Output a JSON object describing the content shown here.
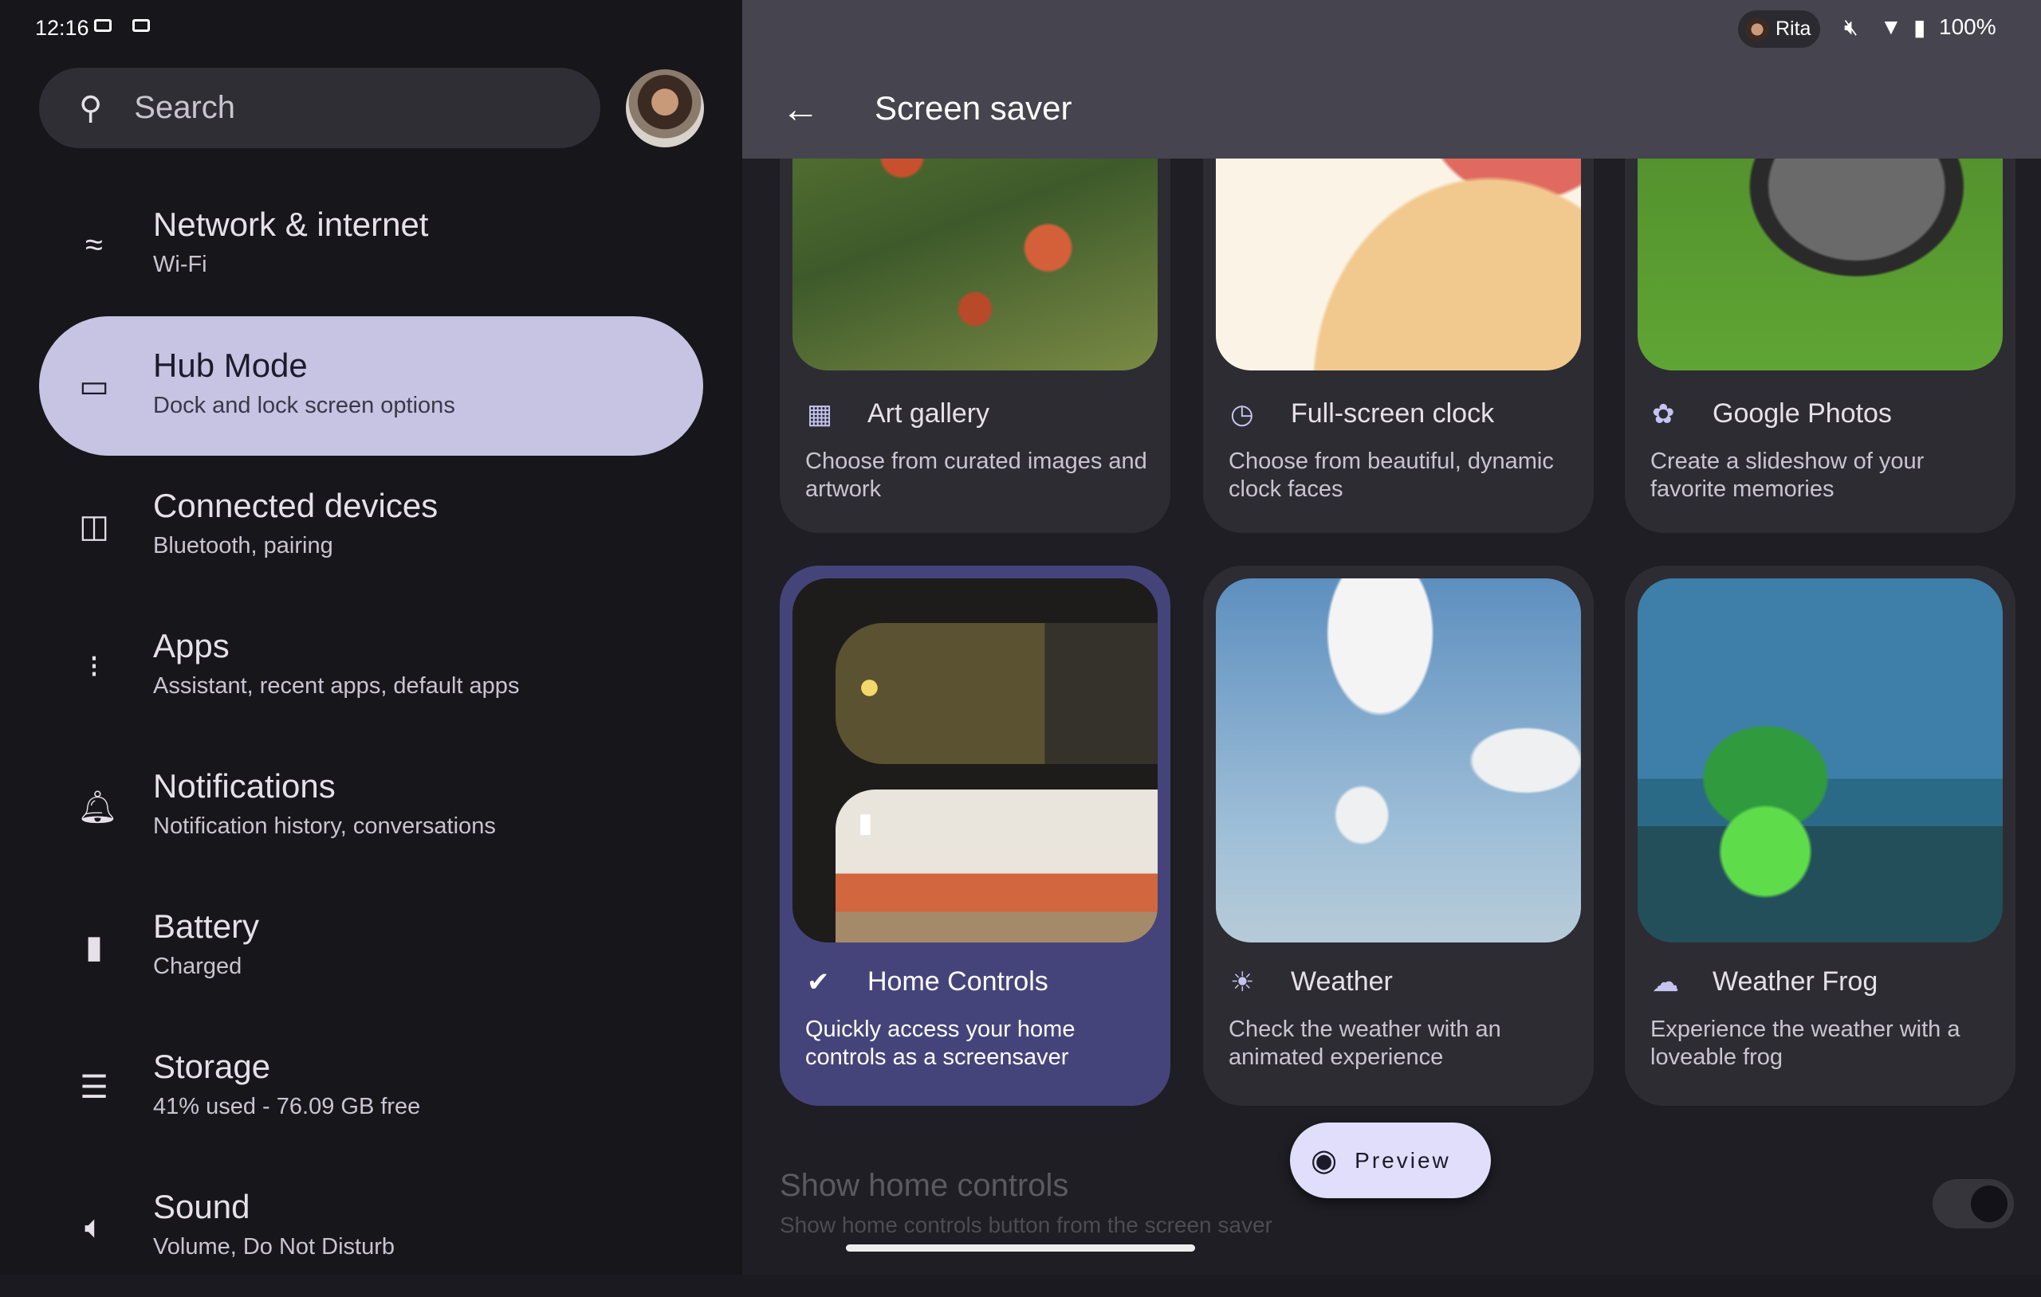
{
  "status_bar": {
    "time": "12:16",
    "user": "Rita",
    "battery": "100%",
    "icons": [
      "video-icon",
      "video-icon",
      "mute-icon",
      "wifi-icon",
      "battery-saver-icon"
    ]
  },
  "sidebar": {
    "search_placeholder": "Search",
    "items": [
      {
        "label": "Network & internet",
        "sub": "Wi-Fi",
        "icon": "wifi-icon"
      },
      {
        "label": "Hub Mode",
        "sub": "Dock and lock screen options",
        "icon": "hub-icon",
        "selected": true
      },
      {
        "label": "Connected devices",
        "sub": "Bluetooth, pairing",
        "icon": "devices-icon"
      },
      {
        "label": "Apps",
        "sub": "Assistant, recent apps, default apps",
        "icon": "apps-grid-icon"
      },
      {
        "label": "Notifications",
        "sub": "Notification history, conversations",
        "icon": "bell-icon"
      },
      {
        "label": "Battery",
        "sub": "Charged",
        "icon": "battery-icon"
      },
      {
        "label": "Storage",
        "sub": "41% used - 76.09 GB free",
        "icon": "storage-icon"
      },
      {
        "label": "Sound",
        "sub": "Volume, Do Not Disturb",
        "icon": "volume-icon"
      }
    ]
  },
  "header": {
    "title": "Screen saver"
  },
  "options": [
    {
      "title": "Art gallery",
      "desc": "Choose from curated images and artwork",
      "icon": "gallery-icon"
    },
    {
      "title": "Full-screen clock",
      "desc": "Choose from beautiful, dynamic clock faces",
      "icon": "clock-icon"
    },
    {
      "title": "Google Photos",
      "desc": "Create a slideshow of your favorite memories",
      "icon": "pinwheel-icon"
    },
    {
      "title": "Home Controls",
      "desc": "Quickly access your home controls as a screensaver",
      "icon": "check-circle-icon",
      "selected": true
    },
    {
      "title": "Weather",
      "desc": "Check the weather with an animated experience",
      "icon": "sun-icon"
    },
    {
      "title": "Weather Frog",
      "desc": "Experience the weather with a loveable frog",
      "icon": "cloud-rain-icon"
    }
  ],
  "preview_label": "Preview",
  "setting": {
    "title": "Show home controls",
    "desc": "Show home controls button from the screen saver",
    "enabled": false
  },
  "colors": {
    "selected_nav": "#c7c3e3",
    "selected_card": "#45447a",
    "preview_bg": "#e0defb"
  }
}
